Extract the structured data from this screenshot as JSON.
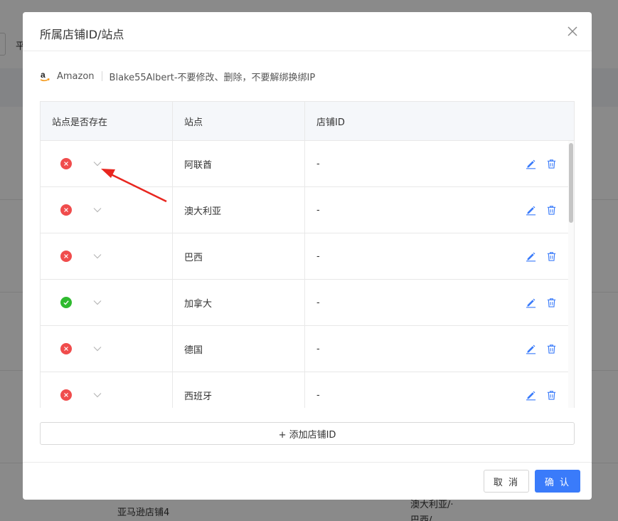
{
  "background": {
    "top_left_btn_text": "平",
    "footer_text_left": "亚马逊店铺4",
    "footer_text_right_1": "澳大利亚/·",
    "footer_text_right_2": "巴西/"
  },
  "modal": {
    "title": "所属店铺ID/站点",
    "account": {
      "platform": "Amazon",
      "name": "Blake55Albert-不要修改、删除，不要解绑换绑IP"
    },
    "table": {
      "headers": [
        "站点是否存在",
        "站点",
        "店铺ID"
      ],
      "rows": [
        {
          "status": "missing",
          "site": "阿联酋",
          "store_id": "-"
        },
        {
          "status": "missing",
          "site": "澳大利亚",
          "store_id": "-"
        },
        {
          "status": "missing",
          "site": "巴西",
          "store_id": "-"
        },
        {
          "status": "exists",
          "site": "加拿大",
          "store_id": "-"
        },
        {
          "status": "missing",
          "site": "德国",
          "store_id": "-"
        },
        {
          "status": "missing",
          "site": "西班牙",
          "store_id": "-"
        }
      ]
    },
    "add_button": "+ 添加店铺ID",
    "cancel_button": "取 消",
    "confirm_button": "确 认"
  },
  "colors": {
    "accent": "#3a7bfa",
    "status_missing": "#f04c4c",
    "status_exists": "#2fba2f",
    "annotation_arrow": "#e8261f"
  }
}
